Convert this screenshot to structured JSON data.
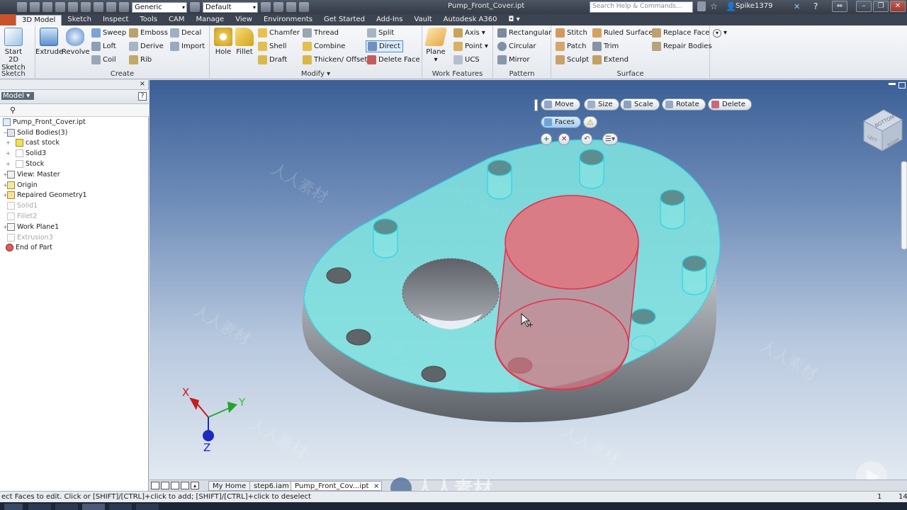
{
  "titlebar": {
    "doc_title": "Pump_Front_Cover.ipt",
    "search_placeholder": "Search Help & Commands...",
    "user": "Spike1379",
    "material": "Generic",
    "appearance": "Default"
  },
  "tabs": [
    "3D Model",
    "Sketch",
    "Inspect",
    "Tools",
    "CAM",
    "Manage",
    "View",
    "Environments",
    "Get Started",
    "Add-Ins",
    "Vault",
    "Autodesk A360"
  ],
  "active_tab": "3D Model",
  "ribbon": {
    "sketch": {
      "start": "Start",
      "start2": "2D Sketch",
      "label": "Sketch"
    },
    "create": {
      "extrude": "Extrude",
      "revolve": "Revolve",
      "sweep": "Sweep",
      "loft": "Loft",
      "coil": "Coil",
      "emboss": "Emboss",
      "derive": "Derive",
      "rib": "Rib",
      "decal": "Decal",
      "import": "Import",
      "label": "Create"
    },
    "modify": {
      "hole": "Hole",
      "fillet": "Fillet",
      "chamfer": "Chamfer",
      "shell": "Shell",
      "draft": "Draft",
      "thread": "Thread",
      "combine": "Combine",
      "thicken": "Thicken/ Offset",
      "split": "Split",
      "direct": "Direct",
      "delete_face": "Delete Face",
      "label": "Modify"
    },
    "work": {
      "plane": "Plane",
      "axis": "Axis",
      "point": "Point",
      "ucs": "UCS",
      "label": "Work Features"
    },
    "pattern": {
      "rectangular": "Rectangular",
      "circular": "Circular",
      "mirror": "Mirror",
      "label": "Pattern"
    },
    "surface": {
      "stitch": "Stitch",
      "patch": "Patch",
      "sculpt": "Sculpt",
      "ruled": "Ruled Surface",
      "trim": "Trim",
      "extend": "Extend",
      "replace": "Replace Face",
      "repair": "Repair Bodies",
      "label": "Surface"
    }
  },
  "browser": {
    "title": "Model",
    "nodes": [
      {
        "label": "Pump_Front_Cover.ipt",
        "dim": false
      },
      {
        "label": "Solid Bodies(3)",
        "dim": false
      },
      {
        "label": "cast stock",
        "dim": false
      },
      {
        "label": "Solid3",
        "dim": false
      },
      {
        "label": "Stock",
        "dim": false
      },
      {
        "label": "View: Master",
        "dim": false
      },
      {
        "label": "Origin",
        "dim": false
      },
      {
        "label": "Repaired Geometry1",
        "dim": false
      },
      {
        "label": "Solid1",
        "dim": true
      },
      {
        "label": "Fillet2",
        "dim": true
      },
      {
        "label": "Work Plane1",
        "dim": false
      },
      {
        "label": "Extrusion3",
        "dim": true
      },
      {
        "label": "End of Part",
        "dim": false
      }
    ]
  },
  "minitoolbar": {
    "move": "Move",
    "size": "Size",
    "scale": "Scale",
    "rotate": "Rotate",
    "delete": "Delete",
    "faces": "Faces"
  },
  "viewcube": {
    "face": "BOTTOM",
    "side": "RIGHT",
    "front": "LEFT"
  },
  "triad": {
    "x": "X",
    "y": "Y",
    "z": "Z"
  },
  "doc_tabs": [
    "My Home",
    "step6.iam",
    "Pump_Front_Cov...ipt"
  ],
  "status": {
    "message": "ect Faces to edit. Click or [SHIFT]/[CTRL]+click to add; [SHIFT]/[CTRL]+click to deselect",
    "n1": "1",
    "n2": "14"
  },
  "watermark": "人人素材",
  "colors": {
    "face_highlight": "#7fe3df",
    "selected_cylinder": "#e04a63",
    "tab_bar": "#3d4451"
  }
}
